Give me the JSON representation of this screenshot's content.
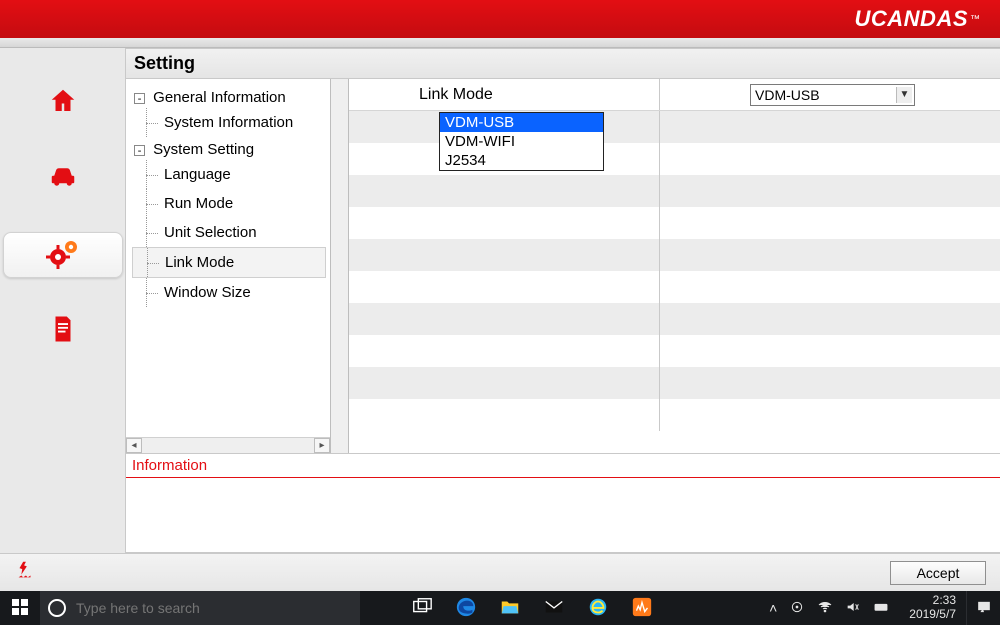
{
  "brand": "UCANDAS",
  "tm": "™",
  "title": "Setting",
  "tree": {
    "group1": "General Information",
    "g1_leaf1": "System Information",
    "group2": "System Setting",
    "g2_leaf1": "Language",
    "g2_leaf2": "Run Mode",
    "g2_leaf3": "Unit Selection",
    "g2_leaf4": "Link Mode",
    "g2_leaf5": "Window Size"
  },
  "grid": {
    "row1_label": "Link Mode",
    "combo_value": "VDM-USB"
  },
  "dropdown": {
    "opt1": "VDM-USB",
    "opt2": "VDM-WIFI",
    "opt3": "J2534"
  },
  "info_header": "Information",
  "accept_label": "Accept",
  "taskbar": {
    "search_placeholder": "Type here to search",
    "time": "2:33",
    "date": "2019/5/7"
  }
}
